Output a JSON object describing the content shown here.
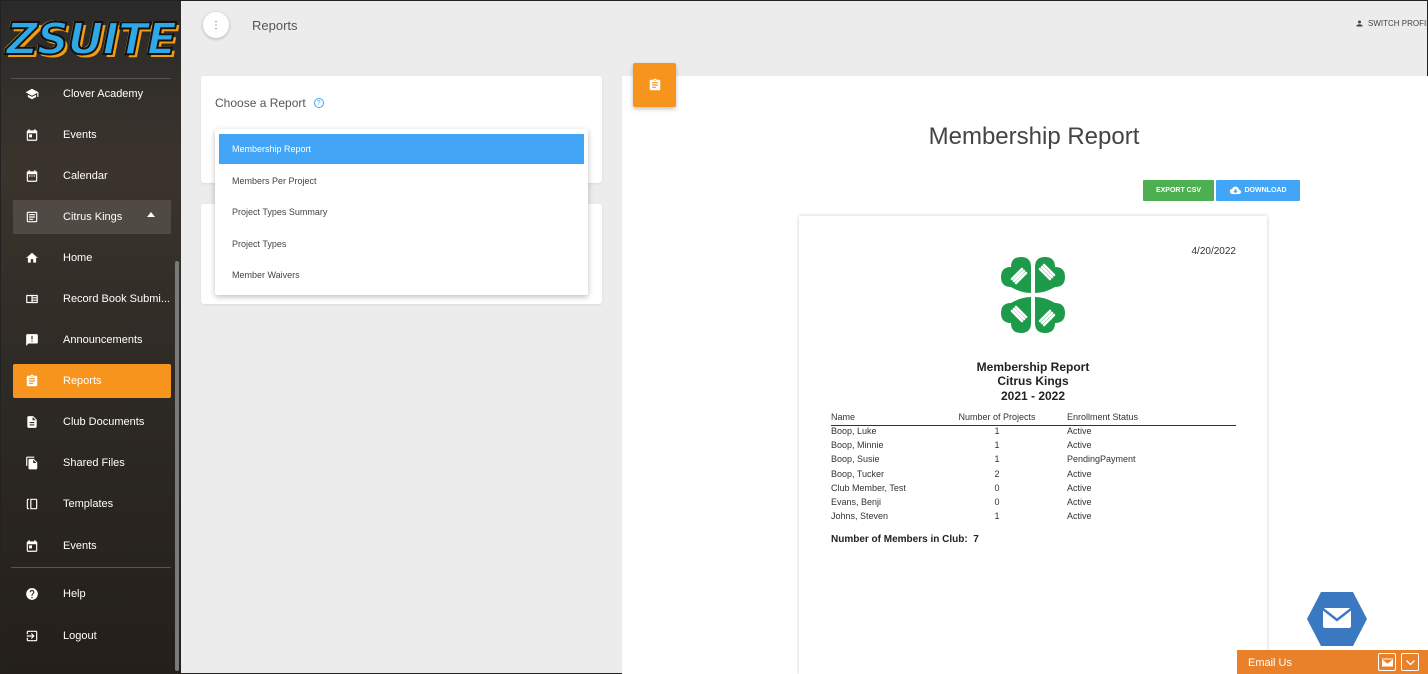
{
  "app": {
    "logo": "ZSUITE"
  },
  "sidebar": {
    "items": [
      {
        "label": "Clover Academy",
        "icon": "graduation-cap-icon"
      },
      {
        "label": "Events",
        "icon": "calendar-event-icon"
      },
      {
        "label": "Calendar",
        "icon": "calendar-icon"
      },
      {
        "label": "Citrus Kings",
        "icon": "club-icon"
      },
      {
        "label": "Home",
        "icon": "home-icon"
      },
      {
        "label": "Record Book Submi...",
        "icon": "record-book-icon"
      },
      {
        "label": "Announcements",
        "icon": "announcement-icon"
      },
      {
        "label": "Reports",
        "icon": "clipboard-icon"
      },
      {
        "label": "Club Documents",
        "icon": "document-icon"
      },
      {
        "label": "Shared Files",
        "icon": "files-icon"
      },
      {
        "label": "Templates",
        "icon": "templates-icon"
      },
      {
        "label": "Events",
        "icon": "calendar-event-icon"
      },
      {
        "label": "Help",
        "icon": "help-icon"
      },
      {
        "label": "Logout",
        "icon": "logout-icon"
      }
    ]
  },
  "topbar": {
    "menu_glyph": "⋮",
    "title": "Reports",
    "switch_profile": "SWITCH PROFILE"
  },
  "choose": {
    "label": "Choose a Report",
    "help_glyph": "?",
    "options": [
      "Membership Report",
      "Members Per Project",
      "Project Types Summary",
      "Project Types",
      "Member Waivers"
    ],
    "selected": "Membership Report"
  },
  "report": {
    "title": "Membership Report",
    "export_label": "EXPORT CSV",
    "download_label": "DOWNLOAD",
    "date": "4/20/2022",
    "heading": [
      "Membership Report",
      "Citrus Kings",
      "2021 - 2022"
    ],
    "columns": [
      "Name",
      "Number of Projects",
      "Enrollment Status"
    ],
    "rows": [
      [
        "Boop, Luke",
        "1",
        "Active"
      ],
      [
        "Boop, Minnie",
        "1",
        "Active"
      ],
      [
        "Boop, Susie",
        "1",
        "PendingPayment"
      ],
      [
        "Boop, Tucker",
        "2",
        "Active"
      ],
      [
        "Club Member, Test",
        "0",
        "Active"
      ],
      [
        "Evans, Benji",
        "0",
        "Active"
      ],
      [
        "Johns, Steven",
        "1",
        "Active"
      ]
    ],
    "count_label": "Number of Members in Club:",
    "count_value": "7"
  },
  "email": {
    "label": "Email Us"
  },
  "colors": {
    "accent": "#f7941d",
    "primary": "#42a5f5",
    "export": "#4caf50",
    "clover": "#1e9a4b"
  }
}
